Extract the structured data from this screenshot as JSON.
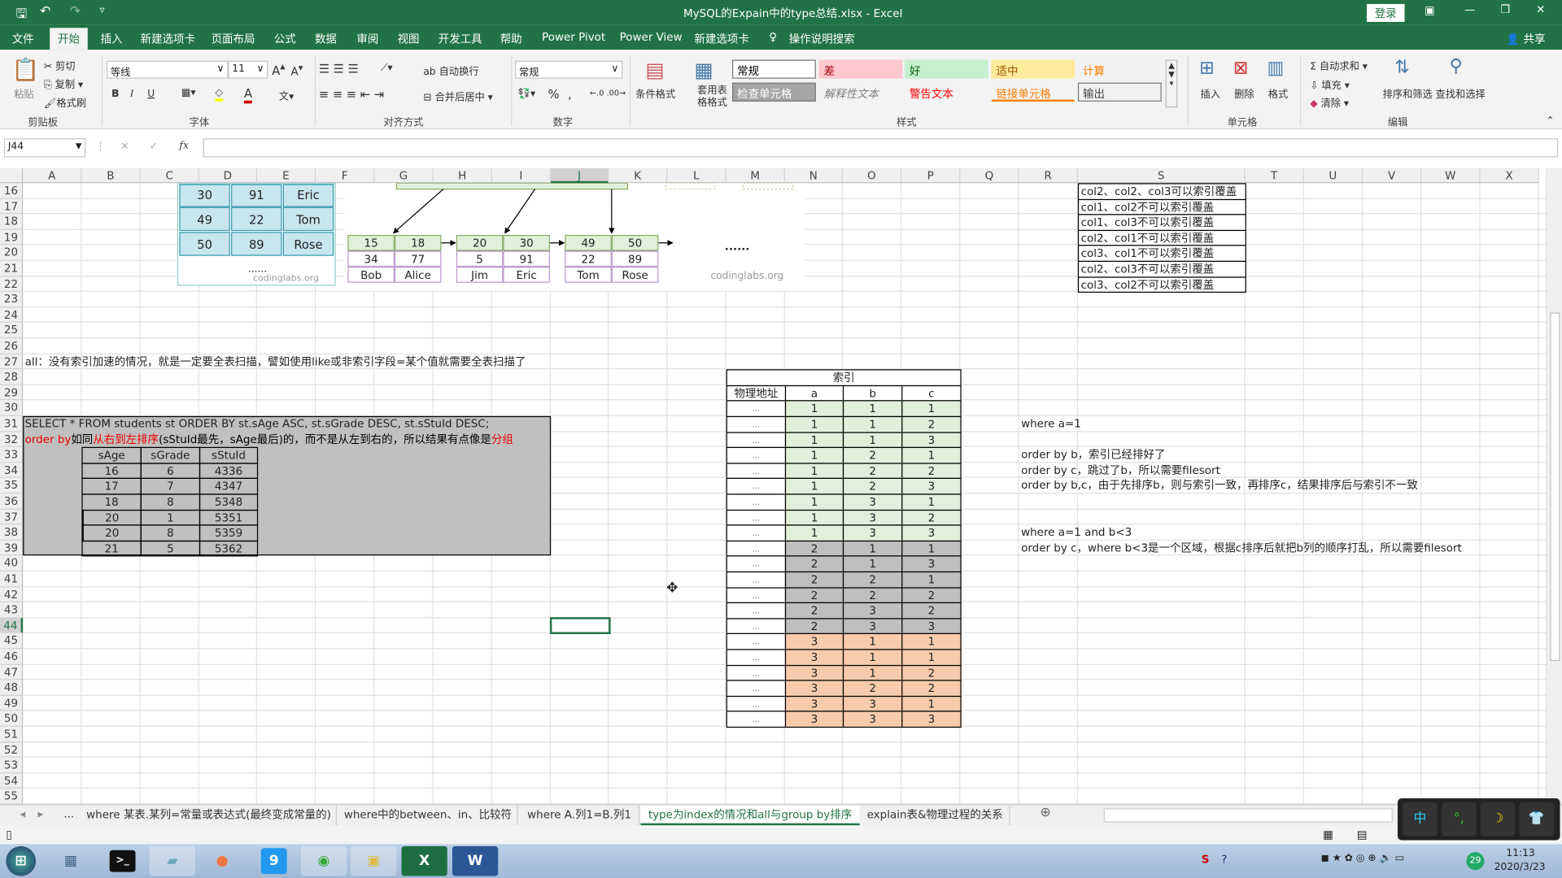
{
  "app": {
    "title": "MySQL的Expain中的type总结.xlsx - Excel",
    "login": "登录",
    "share": "共享"
  },
  "menu": [
    "文件",
    "开始",
    "插入",
    "新建选项卡",
    "页面布局",
    "公式",
    "数据",
    "审阅",
    "视图",
    "开发工具",
    "帮助",
    "Power Pivot",
    "Power View",
    "新建选项卡"
  ],
  "menu_active": 1,
  "tell_me": "操作说明搜索",
  "ribbon": {
    "clipboard": {
      "paste": "粘贴",
      "cut": "剪切",
      "copy": "复制",
      "painter": "格式刷",
      "group": "剪贴板"
    },
    "font": {
      "name": "等线",
      "size": "11",
      "bold": "B",
      "italic": "I",
      "underline": "U",
      "group": "字体"
    },
    "align": {
      "wrap": "自动换行",
      "merge": "合并后居中",
      "group": "对齐方式"
    },
    "number": {
      "format": "常规",
      "percent": "%",
      "comma": ",",
      "group": "数字"
    },
    "styles": {
      "cond": "条件格式",
      "table": "套用表格格式",
      "group": "样式",
      "items": [
        {
          "label": "常规",
          "bg": "#ffffff",
          "fg": "#000000"
        },
        {
          "label": "差",
          "bg": "#ffc7ce",
          "fg": "#9c0006"
        },
        {
          "label": "好",
          "bg": "#c6efce",
          "fg": "#006100"
        },
        {
          "label": "适中",
          "bg": "#ffeb9c",
          "fg": "#9c5700"
        },
        {
          "label": "计算",
          "bg": "#f2f2f2",
          "fg": "#fa7d00"
        },
        {
          "label": "检查单元格",
          "bg": "#a5a5a5",
          "fg": "#ffffff"
        },
        {
          "label": "解释性文本",
          "bg": "#f3f3f3",
          "fg": "#7f7f7f"
        },
        {
          "label": "警告文本",
          "bg": "#f3f3f3",
          "fg": "#ff0000"
        },
        {
          "label": "链接单元格",
          "bg": "#f3f3f3",
          "fg": "#fa7d00"
        },
        {
          "label": "输出",
          "bg": "#f2f2f2",
          "fg": "#3f3f3f"
        }
      ]
    },
    "cells": {
      "insert": "插入",
      "delete": "删除",
      "format": "格式",
      "group": "单元格"
    },
    "edit": {
      "autosum": "自动求和",
      "fill": "填充",
      "clear": "清除",
      "sort": "排序和筛选",
      "find": "查找和选择",
      "group": "编辑"
    }
  },
  "formula": {
    "namebox": "J44",
    "fx": "fx",
    "value": ""
  },
  "columns": [
    "A",
    "B",
    "C",
    "D",
    "E",
    "F",
    "G",
    "H",
    "I",
    "J",
    "K",
    "L",
    "M",
    "N",
    "O",
    "P",
    "Q",
    "R",
    "S",
    "T",
    "U",
    "V",
    "W",
    "X"
  ],
  "selected_column": "J",
  "selected_row": 44,
  "first_row": 16,
  "last_row": 55,
  "image_left": {
    "rows": [
      [
        "30",
        "91",
        "Eric"
      ],
      [
        "49",
        "22",
        "Tom"
      ],
      [
        "50",
        "89",
        "Rose"
      ]
    ],
    "dots": "......",
    "watermark": "codinglabs.org"
  },
  "image_tree": {
    "leaves": [
      [
        [
          "15",
          "18"
        ],
        [
          "34",
          "77"
        ],
        [
          "Bob",
          "Alice"
        ]
      ],
      [
        [
          "20",
          "30"
        ],
        [
          "5",
          "91"
        ],
        [
          "Jim",
          "Eric"
        ]
      ],
      [
        [
          "49",
          "50"
        ],
        [
          "22",
          "89"
        ],
        [
          "Tom",
          "Rose"
        ]
      ]
    ],
    "dots": "......",
    "watermark": "codinglabs.org"
  },
  "covering": [
    "col2、col2、col3可以索引覆盖",
    "col1、col2不可以索引覆盖",
    "col1、col3不可以索引覆盖",
    "col2、col1不可以索引覆盖",
    "col3、col1不可以索引覆盖",
    "col2、col3不可以索引覆盖",
    "col3、col2不可以索引覆盖"
  ],
  "row27": "all：没有索引加速的情况，就是一定要全表扫描，譬如使用like或非索引字段=某个值就需要全表扫描了",
  "sql_block": {
    "query": "SELECT * FROM students st ORDER BY st.sAge ASC, st.sGrade DESC, st.sStuId DESC;",
    "note_parts": [
      {
        "t": "order by",
        "red": true
      },
      {
        "t": "如同",
        "red": false
      },
      {
        "t": "从右到左排序",
        "red": true
      },
      {
        "t": "(sStuId最先，sAge最后)的，而不是从左到右的，所以结果有点像是",
        "red": false
      },
      {
        "t": "分组",
        "red": true
      }
    ],
    "headers": [
      "sAge",
      "sGrade",
      "sStuId"
    ],
    "rows": [
      [
        "16",
        "6",
        "4336"
      ],
      [
        "17",
        "7",
        "4347"
      ],
      [
        "18",
        "8",
        "5348"
      ],
      [
        "20",
        "1",
        "5351"
      ],
      [
        "20",
        "8",
        "5359"
      ],
      [
        "21",
        "5",
        "5362"
      ]
    ]
  },
  "index_table": {
    "title": "索引",
    "headers": [
      "物理地址",
      "a",
      "b",
      "c"
    ],
    "addr": "...",
    "colors": {
      "1": "#e2efda",
      "2": "#bfbfbf",
      "3": "#f8cbad"
    },
    "rows": [
      [
        1,
        1,
        1
      ],
      [
        1,
        1,
        2
      ],
      [
        1,
        1,
        3
      ],
      [
        1,
        2,
        1
      ],
      [
        1,
        2,
        2
      ],
      [
        1,
        2,
        3
      ],
      [
        1,
        3,
        1
      ],
      [
        1,
        3,
        2
      ],
      [
        1,
        3,
        3
      ],
      [
        2,
        1,
        1
      ],
      [
        2,
        1,
        3
      ],
      [
        2,
        2,
        1
      ],
      [
        2,
        2,
        2
      ],
      [
        2,
        3,
        2
      ],
      [
        2,
        3,
        3
      ],
      [
        3,
        1,
        1
      ],
      [
        3,
        1,
        1
      ],
      [
        3,
        1,
        2
      ],
      [
        3,
        2,
        2
      ],
      [
        3,
        3,
        1
      ],
      [
        3,
        3,
        3
      ]
    ]
  },
  "notes": [
    {
      "row": 31,
      "text": "where a=1"
    },
    {
      "row": 33,
      "text": "order by b，索引已经排好了"
    },
    {
      "row": 34,
      "text": "order by c，跳过了b，所以需要filesort"
    },
    {
      "row": 35,
      "text": "order by b,c，由于先排序b，则与索引一致，再排序c，结果排序后与索引不一致"
    },
    {
      "row": 38,
      "text": "where a=1 and b<3"
    },
    {
      "row": 39,
      "text": "order by c，where b<3是一个区域，根据c排序后就把b列的顺序打乱，所以需要filesort"
    }
  ],
  "sheets": {
    "more": "...",
    "tabs": [
      "where 某表.某列=常量或表达式(最终变成常量的)",
      "where中的between、in、比较符",
      "where A.列1=B.列1",
      "type为index的情况和all与group by排序",
      "explain表&物理过程的关系"
    ],
    "active": 3
  },
  "ime": [
    "中",
    "°,",
    "☽",
    "👕"
  ],
  "taskbar": {
    "time": "11:13",
    "date": "2020/3/23",
    "badge": "29"
  }
}
